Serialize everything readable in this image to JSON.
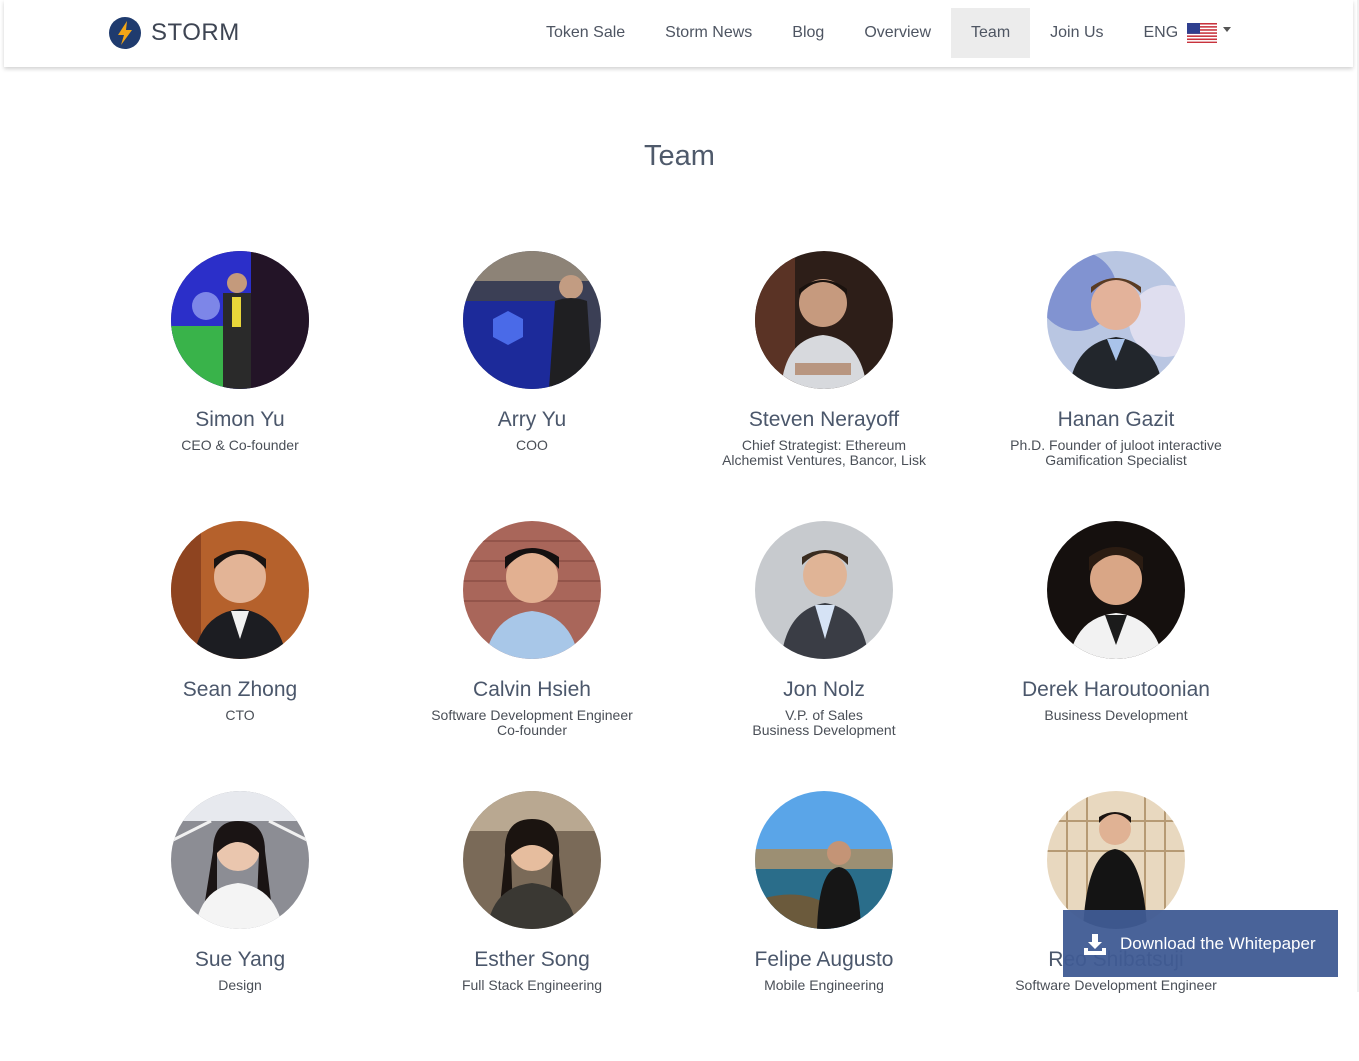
{
  "brand": {
    "name": "STORM",
    "icon": "lightning-bolt-logo"
  },
  "nav": {
    "items": [
      {
        "label": "Token Sale",
        "active": false
      },
      {
        "label": "Storm News",
        "active": false
      },
      {
        "label": "Blog",
        "active": false
      },
      {
        "label": "Overview",
        "active": false
      },
      {
        "label": "Team",
        "active": true
      },
      {
        "label": "Join Us",
        "active": false
      }
    ],
    "language": {
      "code": "ENG",
      "icon": "us-flag-icon"
    }
  },
  "page": {
    "title": "Team"
  },
  "team": [
    {
      "name": "Simon Yu",
      "role": "CEO & Co-founder"
    },
    {
      "name": "Arry Yu",
      "role": "COO"
    },
    {
      "name": "Steven Nerayoff",
      "role": "Chief Strategist: Ethereum\nAlchemist Ventures, Bancor, Lisk"
    },
    {
      "name": "Hanan Gazit",
      "role": "Ph.D. Founder of juloot interactive\nGamification Specialist"
    },
    {
      "name": "Sean Zhong",
      "role": "CTO"
    },
    {
      "name": "Calvin Hsieh",
      "role": "Software Development Engineer\nCo-founder"
    },
    {
      "name": "Jon Nolz",
      "role": "V.P. of Sales\nBusiness Development"
    },
    {
      "name": "Derek Haroutoonian",
      "role": "Business Development"
    },
    {
      "name": "Sue Yang",
      "role": "Design"
    },
    {
      "name": "Esther Song",
      "role": "Full Stack Engineering"
    },
    {
      "name": "Felipe Augusto",
      "role": "Mobile Engineering"
    },
    {
      "name": "Reo Shibatsuji",
      "role": "Software Development Engineer"
    }
  ],
  "whitepaper": {
    "label": "Download the Whitepaper",
    "icon": "download-icon"
  },
  "colors": {
    "accent": "#3f5b94",
    "brand_dark": "#1f3b6e",
    "brand_bolt": "#f2a516"
  }
}
